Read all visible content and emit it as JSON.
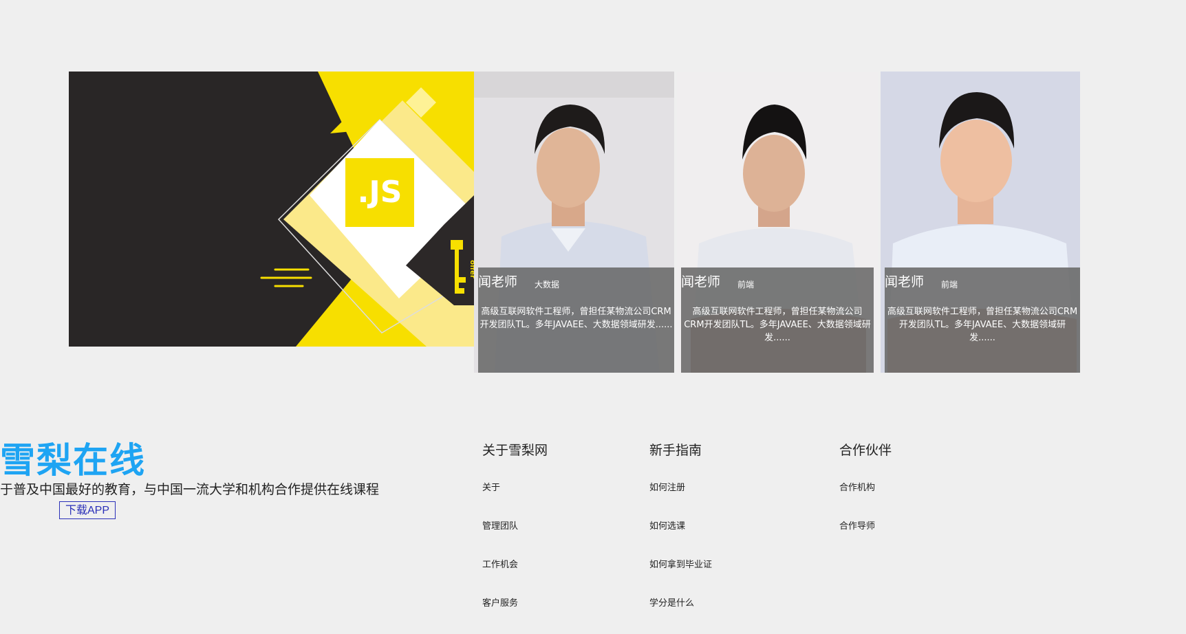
{
  "teachers": [
    {
      "name": "闻老师",
      "tag": "大数据",
      "desc": "高级互联网软件工程师，曾担任某物流公司CRM开发团队TL。多年JAVAEE、大数据领域研发......"
    },
    {
      "name": "闻老师",
      "tag": "前端",
      "desc": "高级互联网软件工程师，曾担任某物流公司CRM开发团队TL。多年JAVAEE、大数据领域研发......"
    },
    {
      "name": "闻老师",
      "tag": "前端",
      "desc": "高级互联网软件工程师，曾担任某物流公司CRM开发团队TL。多年JAVAEE、大数据领域研发......"
    }
  ],
  "banner": {
    "badge": ".JS",
    "key_text": "offer"
  },
  "footer": {
    "brand": "雪梨在线",
    "slogan": "于普及中国最好的教育，与中国一流大学和机构合作提供在线课程",
    "app_button": "下载APP",
    "columns": [
      {
        "title": "关于雪梨网",
        "links": [
          "关于",
          "管理团队",
          "工作机会",
          "客户服务"
        ]
      },
      {
        "title": "新手指南",
        "links": [
          "如何注册",
          "如何选课",
          "如何拿到毕业证",
          "学分是什么"
        ]
      },
      {
        "title": "合作伙伴",
        "links": [
          "合作机构",
          "合作导师"
        ]
      }
    ]
  },
  "colors": {
    "brand": "#1ea4f3",
    "banner_yellow": "#f7df00",
    "banner_dark": "#292626",
    "overlay": "#696969"
  }
}
